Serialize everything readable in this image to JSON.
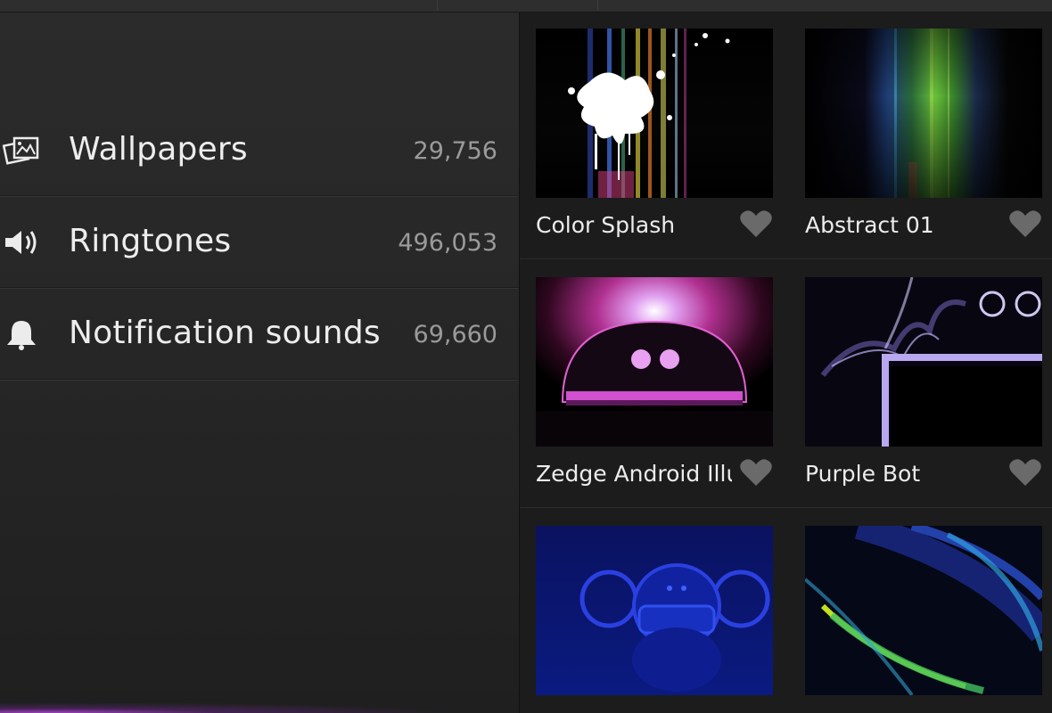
{
  "categories": [
    {
      "label": "Wallpapers",
      "count": "29,756",
      "icon": "wallpapers-icon"
    },
    {
      "label": "Ringtones",
      "count": "496,053",
      "icon": "speaker-icon"
    },
    {
      "label": "Notification sounds",
      "count": "69,660",
      "icon": "bell-icon"
    }
  ],
  "wallpapers": [
    {
      "title": "Color Splash",
      "favorite": false
    },
    {
      "title": "Abstract 01",
      "favorite": false
    },
    {
      "title": "Zedge Android Illu",
      "favorite": false
    },
    {
      "title": "Purple Bot",
      "favorite": false
    },
    {
      "title": "",
      "favorite": false
    },
    {
      "title": "",
      "favorite": false
    }
  ],
  "colors": {
    "background": "#1e1e1e",
    "text": "#ededed",
    "count_text": "#9a9a9a",
    "heart": "#6a6a6a"
  }
}
